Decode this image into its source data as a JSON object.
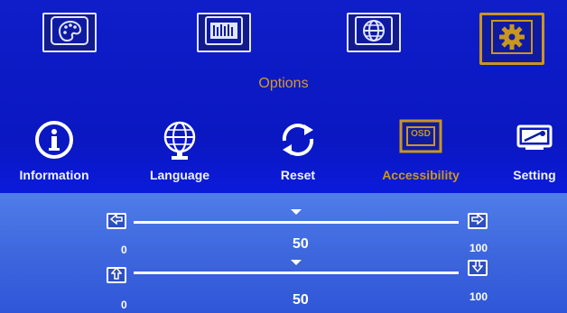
{
  "top_menu": {
    "items": [
      {
        "icon": "palette-icon",
        "active": false
      },
      {
        "icon": "picture-adjust-icon",
        "active": false
      },
      {
        "icon": "globe-icon",
        "active": false
      },
      {
        "icon": "gear-icon",
        "active": true
      }
    ]
  },
  "options_title": "Options",
  "sub_menu": {
    "items": [
      {
        "label": "Information",
        "icon": "info-icon",
        "active": false
      },
      {
        "label": "Language",
        "icon": "globe-icon",
        "active": false
      },
      {
        "label": "Reset",
        "icon": "refresh-icon",
        "active": false
      },
      {
        "label": "Accessibility",
        "icon": "osd-icon",
        "active": true
      },
      {
        "label": "Setting",
        "icon": "device-setting-icon",
        "active": false
      }
    ],
    "osd_text": "OSD"
  },
  "sliders": [
    {
      "min": "0",
      "max": "100",
      "value": "50",
      "left_icon": "arrow-left-icon",
      "right_icon": "arrow-right-icon",
      "value_fraction": 0.5
    },
    {
      "min": "0",
      "max": "100",
      "value": "50",
      "left_icon": "arrow-up-icon",
      "right_icon": "arrow-down-icon",
      "value_fraction": 0.5
    }
  ],
  "colors": {
    "background": "#0a1ad0",
    "accent": "#c99620",
    "panel": "#3e67de",
    "text": "#ffffff"
  }
}
